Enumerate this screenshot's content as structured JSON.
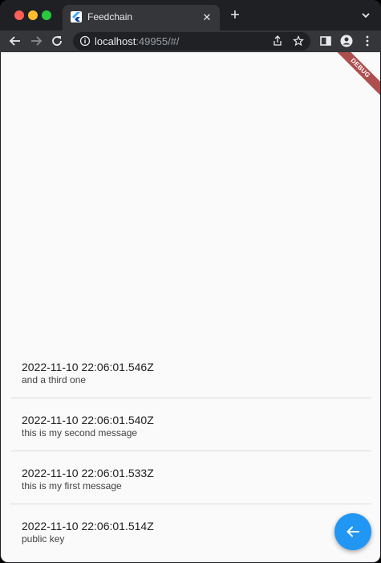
{
  "browser": {
    "tab": {
      "title": "Feedchain",
      "favicon": "flutter-icon",
      "close_glyph": "✕"
    },
    "new_tab_glyph": "+",
    "toolbar": {
      "back": "back-arrow-icon",
      "forward": "forward-arrow-icon",
      "reload": "reload-icon",
      "url_host": "localhost",
      "url_path": ":49955/#/",
      "share": "share-icon",
      "bookmark": "star-icon",
      "side_panel": "side-panel-icon",
      "profile": "profile-icon",
      "menu": "kebab-menu-icon"
    }
  },
  "page": {
    "debug_banner": "DEBUG",
    "feed": [
      {
        "timestamp": "2022-11-10 22:06:01.546Z",
        "message": "and a third one"
      },
      {
        "timestamp": "2022-11-10 22:06:01.540Z",
        "message": "this is my second message"
      },
      {
        "timestamp": "2022-11-10 22:06:01.533Z",
        "message": "this is my first message"
      },
      {
        "timestamp": "2022-11-10 22:06:01.514Z",
        "message": "public key"
      }
    ],
    "fab": {
      "icon": "arrow-back-icon",
      "color": "#2196f3"
    }
  },
  "colors": {
    "page_background": "#fafafa",
    "browser_chrome": "#35363a",
    "divider": "#dcdcdc"
  }
}
